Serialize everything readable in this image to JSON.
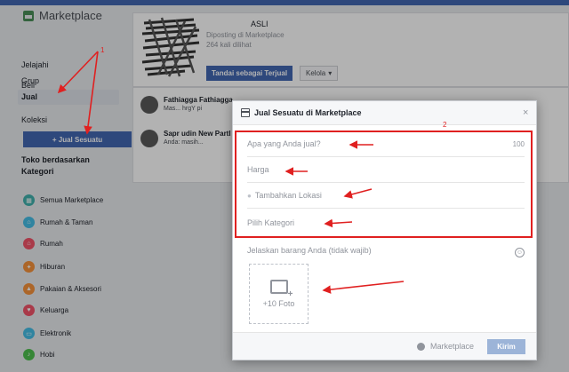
{
  "sidebar": {
    "title": "Marketplace",
    "nav": [
      {
        "label": "Jelajahi"
      },
      {
        "label": "Grup"
      },
      {
        "label": "Beli"
      },
      {
        "label": "Jual"
      },
      {
        "label": "Koleksi"
      }
    ],
    "sell_button": "+ Jual Sesuatu",
    "section_title": "Toko berdasarkan Kategori",
    "categories": [
      {
        "label": "Semua Marketplace",
        "color": "#3fb0ac",
        "icon": "grid-icon"
      },
      {
        "label": "Rumah & Taman",
        "color": "#45bde5",
        "icon": "house-icon"
      },
      {
        "label": "Rumah",
        "color": "#f35369",
        "icon": "home-icon"
      },
      {
        "label": "Hiburan",
        "color": "#f7923b",
        "icon": "ticket-icon"
      },
      {
        "label": "Pakaian & Aksesori",
        "color": "#f7923b",
        "icon": "shirt-icon"
      },
      {
        "label": "Keluarga",
        "color": "#f35369",
        "icon": "heart-icon"
      },
      {
        "label": "Elektronik",
        "color": "#45bde5",
        "icon": "device-icon"
      },
      {
        "label": "Hobi",
        "color": "#4ec14e",
        "icon": "guitar-icon"
      }
    ]
  },
  "listing": {
    "title": "ASLI",
    "posted": "Diposting di Marketplace",
    "views": "264 kali dilihat",
    "mark_sold": "Tandai sebagai Terjual",
    "manage": "Kelola"
  },
  "messages": [
    {
      "name": "Fathiagga Fathiagga",
      "preview": "Mas... hrgY pi"
    },
    {
      "name": "Sapr udin New Partl",
      "preview": "Anda: masih..."
    }
  ],
  "modal": {
    "title": "Jual Sesuatu di Marketplace",
    "close": "×",
    "item_placeholder": "Apa yang Anda jual?",
    "char_count": "100",
    "price_placeholder": "Harga",
    "location_placeholder": "Tambahkan Lokasi",
    "category_placeholder": "Pilih Kategori",
    "description_placeholder": "Jelaskan barang Anda (tidak wajib)",
    "photo_label": "+10 Foto",
    "audience": "Marketplace",
    "send": "Kirim"
  },
  "annotations": {
    "label_1": "1",
    "label_2": "2",
    "color": "#e02020"
  }
}
